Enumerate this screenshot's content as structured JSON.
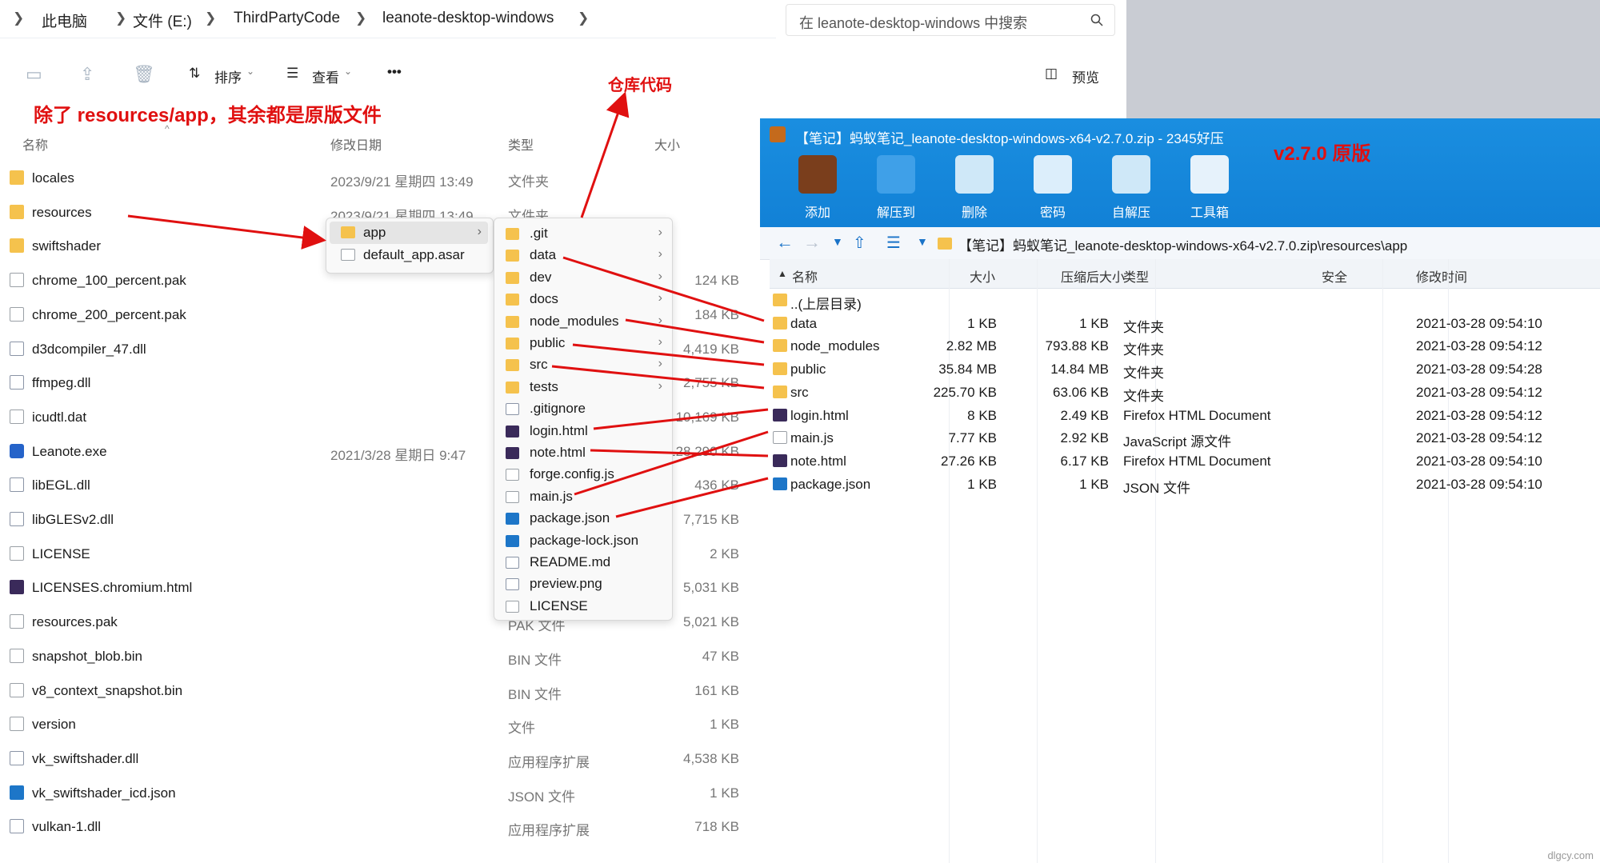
{
  "explorer": {
    "breadcrumb": [
      "此电脑",
      "文件 (E:)",
      "ThirdPartyCode",
      "leanote-desktop-windows"
    ],
    "search_placeholder": "在 leanote-desktop-windows 中搜索",
    "toolbar": {
      "sort": "排序",
      "view": "查看",
      "more": "•••",
      "preview": "预览"
    },
    "columns": {
      "name": "名称",
      "date": "修改日期",
      "type": "类型",
      "size": "大小"
    },
    "files": [
      {
        "name": "locales",
        "icon": "folder",
        "date": "2023/9/21 星期四 13:49",
        "type": "文件夹",
        "size": ""
      },
      {
        "name": "resources",
        "icon": "folder",
        "date": "2023/9/21 星期四 13:49",
        "type": "文件夹",
        "size": ""
      },
      {
        "name": "swiftshader",
        "icon": "folder",
        "date": "",
        "type": "",
        "size": ""
      },
      {
        "name": "chrome_100_percent.pak",
        "icon": "doc",
        "date": "",
        "type": "",
        "size": "124 KB"
      },
      {
        "name": "chrome_200_percent.pak",
        "icon": "doc",
        "date": "",
        "type": "",
        "size": "184 KB"
      },
      {
        "name": "d3dcompiler_47.dll",
        "icon": "dll",
        "date": "",
        "type": "",
        "size": "4,419 KB"
      },
      {
        "name": "ffmpeg.dll",
        "icon": "dll",
        "date": "",
        "type": "",
        "size": "2,755 KB"
      },
      {
        "name": "icudtl.dat",
        "icon": "doc",
        "date": "",
        "type": "",
        "size": "10,169 KB"
      },
      {
        "name": "Leanote.exe",
        "icon": "exe",
        "date": "2021/3/28 星期日 9:47",
        "type": "",
        "size": "128,290 KB"
      },
      {
        "name": "libEGL.dll",
        "icon": "dll",
        "date": "",
        "type": "",
        "size": "436 KB"
      },
      {
        "name": "libGLESv2.dll",
        "icon": "dll",
        "date": "",
        "type": "",
        "size": "7,715 KB"
      },
      {
        "name": "LICENSE",
        "icon": "doc",
        "date": "",
        "type": "",
        "size": "2 KB"
      },
      {
        "name": "LICENSES.chromium.html",
        "icon": "html",
        "date": "",
        "type": "",
        "size": "5,031 KB"
      },
      {
        "name": "resources.pak",
        "icon": "doc",
        "date": "",
        "type": "PAK 文件",
        "size": "5,021 KB"
      },
      {
        "name": "snapshot_blob.bin",
        "icon": "doc",
        "date": "",
        "type": "BIN 文件",
        "size": "47 KB"
      },
      {
        "name": "v8_context_snapshot.bin",
        "icon": "doc",
        "date": "",
        "type": "BIN 文件",
        "size": "161 KB"
      },
      {
        "name": "version",
        "icon": "doc",
        "date": "",
        "type": "文件",
        "size": "1 KB"
      },
      {
        "name": "vk_swiftshader.dll",
        "icon": "dll",
        "date": "",
        "type": "应用程序扩展",
        "size": "4,538 KB"
      },
      {
        "name": "vk_swiftshader_icd.json",
        "icon": "json",
        "date": "",
        "type": "JSON 文件",
        "size": "1 KB"
      },
      {
        "name": "vulkan-1.dll",
        "icon": "dll",
        "date": "",
        "type": "应用程序扩展",
        "size": "718 KB"
      }
    ]
  },
  "menu_resources": [
    {
      "label": "app",
      "icon": "folder",
      "submenu": true,
      "selected": true
    },
    {
      "label": "default_app.asar",
      "icon": "doc",
      "submenu": false,
      "selected": false
    }
  ],
  "menu_app": [
    {
      "label": ".git",
      "icon": "folder",
      "submenu": true
    },
    {
      "label": "data",
      "icon": "folder",
      "submenu": true
    },
    {
      "label": "dev",
      "icon": "folder",
      "submenu": true
    },
    {
      "label": "docs",
      "icon": "folder",
      "submenu": true
    },
    {
      "label": "node_modules",
      "icon": "folder",
      "submenu": true
    },
    {
      "label": "public",
      "icon": "folder",
      "submenu": true
    },
    {
      "label": "src",
      "icon": "folder",
      "submenu": true
    },
    {
      "label": "tests",
      "icon": "folder",
      "submenu": true
    },
    {
      "label": ".gitignore",
      "icon": "dll",
      "submenu": false
    },
    {
      "label": "login.html",
      "icon": "html",
      "submenu": false
    },
    {
      "label": "note.html",
      "icon": "html",
      "submenu": false
    },
    {
      "label": "forge.config.js",
      "icon": "doc",
      "submenu": false
    },
    {
      "label": "main.js",
      "icon": "doc",
      "submenu": false
    },
    {
      "label": "package.json",
      "icon": "json",
      "submenu": false
    },
    {
      "label": "package-lock.json",
      "icon": "json",
      "submenu": false
    },
    {
      "label": "README.md",
      "icon": "dll",
      "submenu": false
    },
    {
      "label": "preview.png",
      "icon": "dll",
      "submenu": false
    },
    {
      "label": "LICENSE",
      "icon": "doc",
      "submenu": false
    }
  ],
  "annotations": {
    "left": "除了 resources/app，其余都是原版文件",
    "repo": "仓库代码",
    "zip": "v2.7.0 原版"
  },
  "zip": {
    "title": "【笔记】蚂蚁笔记_leanote-desktop-windows-x64-v2.7.0.zip - 2345好压",
    "buttons": [
      "添加",
      "解压到",
      "删除",
      "密码",
      "自解压",
      "工具箱"
    ],
    "path": "【笔记】蚂蚁笔记_leanote-desktop-windows-x64-v2.7.0.zip\\resources\\app",
    "columns": {
      "name": "名称",
      "size": "大小",
      "packed": "压缩后大小",
      "type": "类型",
      "security": "安全",
      "modified": "修改时间"
    },
    "rows": [
      {
        "name": "..(上层目录)",
        "icon": "folder",
        "size": "",
        "packed": "",
        "type": "",
        "modified": ""
      },
      {
        "name": "data",
        "icon": "folder",
        "size": "1 KB",
        "packed": "1 KB",
        "type": "文件夹",
        "modified": "2021-03-28 09:54:10"
      },
      {
        "name": "node_modules",
        "icon": "folder",
        "size": "2.82 MB",
        "packed": "793.88 KB",
        "type": "文件夹",
        "modified": "2021-03-28 09:54:12"
      },
      {
        "name": "public",
        "icon": "folder",
        "size": "35.84 MB",
        "packed": "14.84 MB",
        "type": "文件夹",
        "modified": "2021-03-28 09:54:28"
      },
      {
        "name": "src",
        "icon": "folder",
        "size": "225.70 KB",
        "packed": "63.06 KB",
        "type": "文件夹",
        "modified": "2021-03-28 09:54:12"
      },
      {
        "name": "login.html",
        "icon": "html",
        "size": "8 KB",
        "packed": "2.49 KB",
        "type": "Firefox HTML Document",
        "modified": "2021-03-28 09:54:12"
      },
      {
        "name": "main.js",
        "icon": "doc",
        "size": "7.77 KB",
        "packed": "2.92 KB",
        "type": "JavaScript 源文件",
        "modified": "2021-03-28 09:54:12"
      },
      {
        "name": "note.html",
        "icon": "html",
        "size": "27.26 KB",
        "packed": "6.17 KB",
        "type": "Firefox HTML Document",
        "modified": "2021-03-28 09:54:10"
      },
      {
        "name": "package.json",
        "icon": "json",
        "size": "1 KB",
        "packed": "1 KB",
        "type": "JSON 文件",
        "modified": "2021-03-28 09:54:10"
      }
    ]
  },
  "watermark": "dlgcy.com",
  "colors": {
    "annotation_red": "#e01010",
    "zip_blue": "#1281d6",
    "folder_yellow": "#f5c24d"
  }
}
